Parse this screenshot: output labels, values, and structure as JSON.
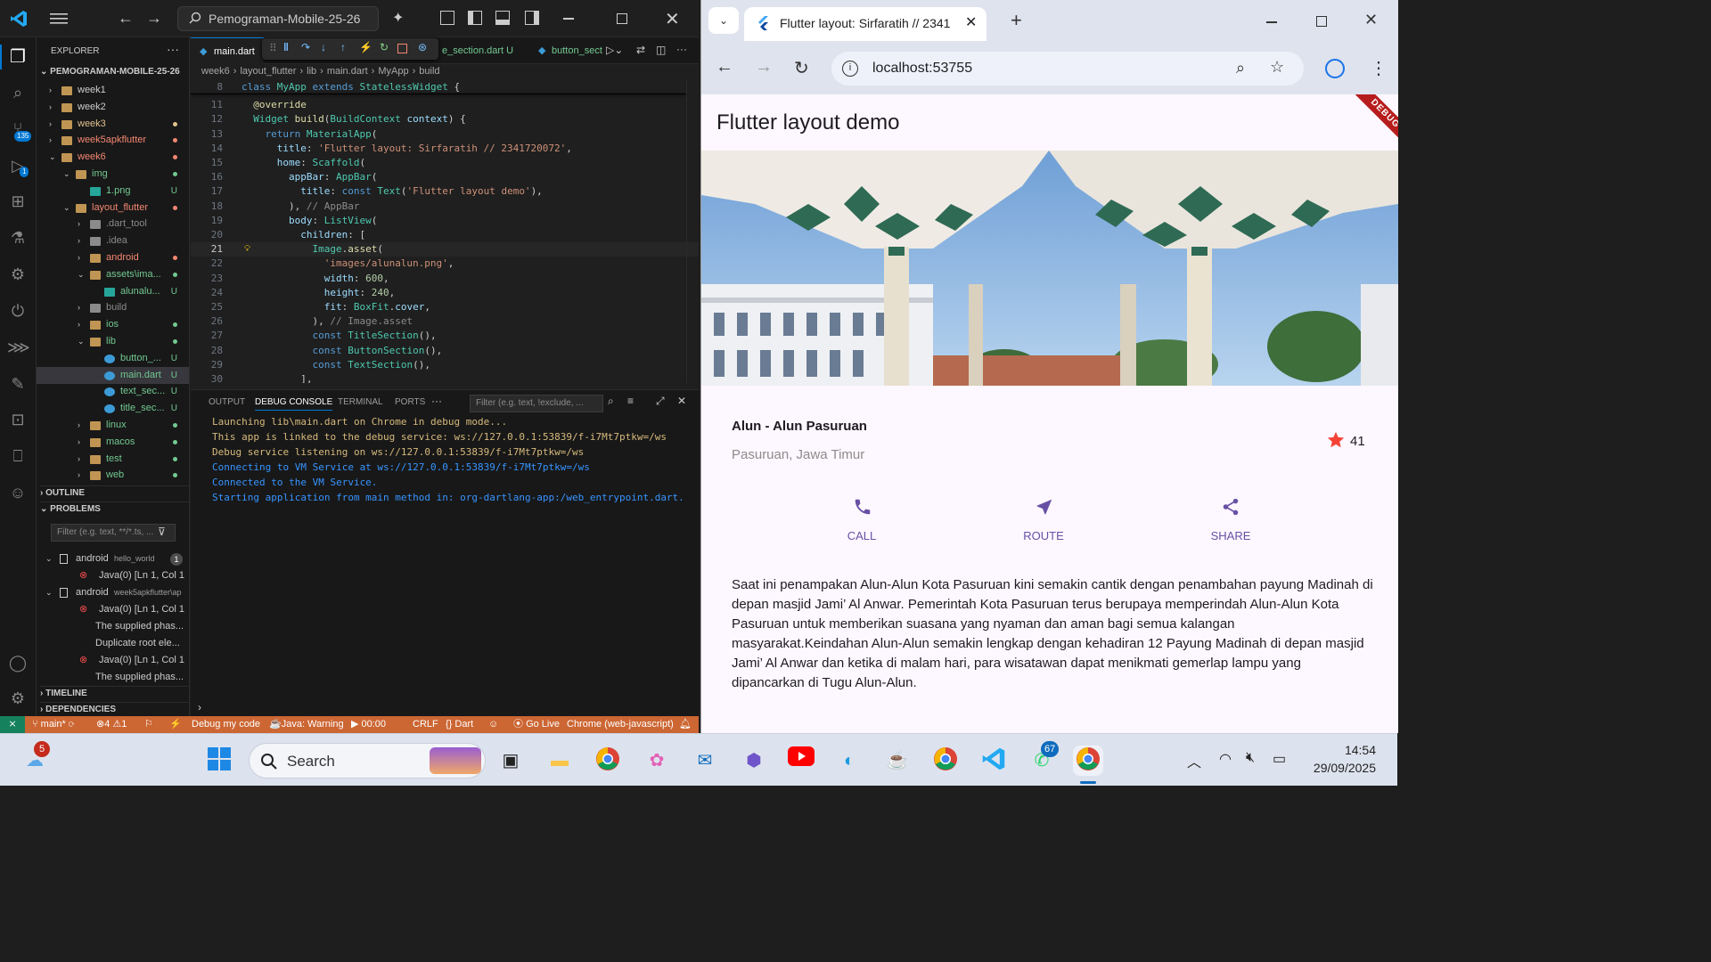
{
  "vscode": {
    "search_text": "Pemograman-Mobile-25-26",
    "explorer_title": "EXPLORER",
    "root": "PEMOGRAMAN-MOBILE-25-26",
    "tree": [
      {
        "name": "week1",
        "level": 1,
        "type": "folder",
        "open": false,
        "color": "#cccccc",
        "dot": ""
      },
      {
        "name": "week2",
        "level": 1,
        "type": "folder",
        "open": false,
        "color": "#cccccc",
        "dot": ""
      },
      {
        "name": "week3",
        "level": 1,
        "type": "folder",
        "open": false,
        "color": "#e2c08d",
        "dot": "#e2c08d"
      },
      {
        "name": "week5apkflutter",
        "level": 1,
        "type": "folder",
        "open": false,
        "color": "#f48771",
        "dot": "#f48771"
      },
      {
        "name": "week6",
        "level": 1,
        "type": "folder",
        "open": true,
        "color": "#f48771",
        "dot": "#f48771"
      },
      {
        "name": "img",
        "level": 2,
        "type": "folder",
        "open": true,
        "color": "#73c991",
        "dot": "#73c991"
      },
      {
        "name": "1.png",
        "level": 3,
        "type": "image",
        "open": false,
        "color": "#73c991",
        "status": "U"
      },
      {
        "name": "layout_flutter",
        "level": 2,
        "type": "folder",
        "open": true,
        "color": "#f48771",
        "dot": "#f48771"
      },
      {
        "name": ".dart_tool",
        "level": 3,
        "type": "folder",
        "open": false,
        "color": "#8b8b8b",
        "dot": ""
      },
      {
        "name": ".idea",
        "level": 3,
        "type": "folder",
        "open": false,
        "color": "#8b8b8b",
        "dot": ""
      },
      {
        "name": "android",
        "level": 3,
        "type": "folder",
        "open": false,
        "color": "#f48771",
        "dot": "#f48771"
      },
      {
        "name": "assets\\ima...",
        "level": 3,
        "type": "folder",
        "open": true,
        "color": "#73c991",
        "dot": "#73c991"
      },
      {
        "name": "alunalu...",
        "level": 4,
        "type": "image",
        "open": false,
        "color": "#73c991",
        "status": "U"
      },
      {
        "name": "build",
        "level": 3,
        "type": "folder",
        "open": false,
        "color": "#8b8b8b",
        "dot": ""
      },
      {
        "name": "ios",
        "level": 3,
        "type": "folder",
        "open": false,
        "color": "#73c991",
        "dot": "#73c991"
      },
      {
        "name": "lib",
        "level": 3,
        "type": "folder",
        "open": true,
        "color": "#73c991",
        "dot": "#73c991"
      },
      {
        "name": "button_...",
        "level": 4,
        "type": "dart",
        "open": false,
        "color": "#73c991",
        "status": "U"
      },
      {
        "name": "main.dart",
        "level": 4,
        "type": "dart",
        "open": false,
        "color": "#73c991",
        "status": "U",
        "selected": true
      },
      {
        "name": "text_sec...",
        "level": 4,
        "type": "dart",
        "open": false,
        "color": "#73c991",
        "status": "U"
      },
      {
        "name": "title_sec...",
        "level": 4,
        "type": "dart",
        "open": false,
        "color": "#73c991",
        "status": "U"
      },
      {
        "name": "linux",
        "level": 3,
        "type": "folder",
        "open": false,
        "color": "#73c991",
        "dot": "#73c991"
      },
      {
        "name": "macos",
        "level": 3,
        "type": "folder",
        "open": false,
        "color": "#73c991",
        "dot": "#73c991"
      },
      {
        "name": "test",
        "level": 3,
        "type": "folder",
        "open": false,
        "color": "#73c991",
        "dot": "#73c991"
      },
      {
        "name": "web",
        "level": 3,
        "type": "folder",
        "open": false,
        "color": "#73c991",
        "dot": "#73c991"
      }
    ],
    "outline": "OUTLINE",
    "problems": "PROBLEMS",
    "problems_filter": "Filter (e.g. text, **/*.ts, ...",
    "problem_items": [
      {
        "kind": "group",
        "text": "android",
        "sub": "hello_world",
        "count": "1"
      },
      {
        "kind": "error",
        "text": "Java(0)  [Ln 1, Col 1"
      },
      {
        "kind": "group",
        "text": "android",
        "sub": "week5apkflutter\\ap"
      },
      {
        "kind": "error",
        "text": "Java(0)  [Ln 1, Col 1"
      },
      {
        "kind": "msg",
        "text": "The supplied phas..."
      },
      {
        "kind": "msg",
        "text": "Duplicate root ele..."
      },
      {
        "kind": "error",
        "text": "Java(0)  [Ln 1, Col 1"
      },
      {
        "kind": "msg",
        "text": "The supplied phas..."
      }
    ],
    "timeline": "TIMELINE",
    "dependencies": "DEPENDENCIES",
    "tabs": [
      {
        "label": "main.dart",
        "active": true
      },
      {
        "label": "e_section.dart U",
        "active": false
      },
      {
        "label": "button_sect",
        "active": false
      }
    ],
    "breadcrumb": [
      "week6",
      "layout_flutter",
      "lib",
      "main.dart",
      "MyApp",
      "build"
    ],
    "code": [
      {
        "n": "8",
        "t": "class MyApp extends StatelessWidget {"
      },
      {
        "n": "11",
        "t": "  @override"
      },
      {
        "n": "12",
        "t": "  Widget build(BuildContext context) {"
      },
      {
        "n": "13",
        "t": "    return MaterialApp("
      },
      {
        "n": "14",
        "t": "      title: 'Flutter layout: Sirfaratih // 2341720072',"
      },
      {
        "n": "15",
        "t": "      home: Scaffold("
      },
      {
        "n": "16",
        "t": "        appBar: AppBar("
      },
      {
        "n": "17",
        "t": "          title: const Text('Flutter layout demo'),"
      },
      {
        "n": "18",
        "t": "        ), // AppBar"
      },
      {
        "n": "19",
        "t": "        body: ListView("
      },
      {
        "n": "20",
        "t": "          children: ["
      },
      {
        "n": "21",
        "t": "            Image.asset("
      },
      {
        "n": "22",
        "t": "              'images/alunalun.png',"
      },
      {
        "n": "23",
        "t": "              width: 600,"
      },
      {
        "n": "24",
        "t": "              height: 240,"
      },
      {
        "n": "25",
        "t": "              fit: BoxFit.cover,"
      },
      {
        "n": "26",
        "t": "            ), // Image.asset"
      },
      {
        "n": "27",
        "t": "            const TitleSection(),"
      },
      {
        "n": "28",
        "t": "            const ButtonSection(),"
      },
      {
        "n": "29",
        "t": "            const TextSection(),"
      },
      {
        "n": "30",
        "t": "          ],"
      }
    ],
    "panel_tabs": [
      "OUTPUT",
      "DEBUG CONSOLE",
      "TERMINAL",
      "PORTS"
    ],
    "panel_filter": "Filter (e.g. text, !exclude, ...",
    "console": [
      {
        "t": "Launching lib\\main.dart on Chrome in debug mode...",
        "c": "#d7ba7d"
      },
      {
        "t": "This app is linked to the debug service: ws://127.0.0.1:53839/f-i7Mt7ptkw=/ws",
        "c": "#d7ba7d"
      },
      {
        "t": "Debug service listening on ws://127.0.0.1:53839/f-i7Mt7ptkw=/ws",
        "c": "#d7ba7d"
      },
      {
        "t": "Connecting to VM Service at ws://127.0.0.1:53839/f-i7Mt7ptkw=/ws",
        "c": "#3794ff"
      },
      {
        "t": "Connected to the VM Service.",
        "c": "#3794ff"
      },
      {
        "t": "Starting application from main method in: org-dartlang-app:/web_entrypoint.dart.",
        "c": "#3794ff"
      }
    ],
    "status": {
      "branch": "main*",
      "errors": "4",
      "warnings": "1",
      "debug": "Debug my code",
      "java": "Java: Warning",
      "timer": "00:00",
      "eol": "CRLF",
      "lang": "Dart",
      "golive": "Go Live",
      "target": "Chrome (web-javascript)"
    },
    "badges": {
      "scm": "135",
      "run": "1"
    }
  },
  "browser": {
    "tab_title": "Flutter layout: Sirfaratih // 2341",
    "url": "localhost:53755",
    "app": {
      "appbar_title": "Flutter layout demo",
      "debug_banner": "DEBUG",
      "place_title": "Alun - Alun Pasuruan",
      "place_subtitle": "Pasuruan, Jawa Timur",
      "rating": "41",
      "buttons": [
        "CALL",
        "ROUTE",
        "SHARE"
      ],
      "description": "Saat ini penampakan Alun-Alun Kota Pasuruan kini semakin cantik dengan penambahan payung Madinah di depan masjid Jami’ Al Anwar. Pemerintah Kota Pasuruan terus berupaya memperindah Alun-Alun Kota Pasuruan untuk memberikan suasana yang nyaman dan aman bagi semua kalangan masyarakat.Keindahan Alun-Alun semakin lengkap dengan kehadiran 12 Payung Madinah di depan masjid Jami’ Al Anwar dan ketika di malam hari, para wisatawan dapat menikmati gemerlap lampu yang dipancarkan di Tugu Alun-Alun.",
      "accent": "#6750a4",
      "star_color": "#f44336"
    }
  },
  "taskbar": {
    "weather_badge": "5",
    "search": "Search",
    "whatsapp_badge": "67",
    "time": "14:54",
    "date": "29/09/2025"
  }
}
